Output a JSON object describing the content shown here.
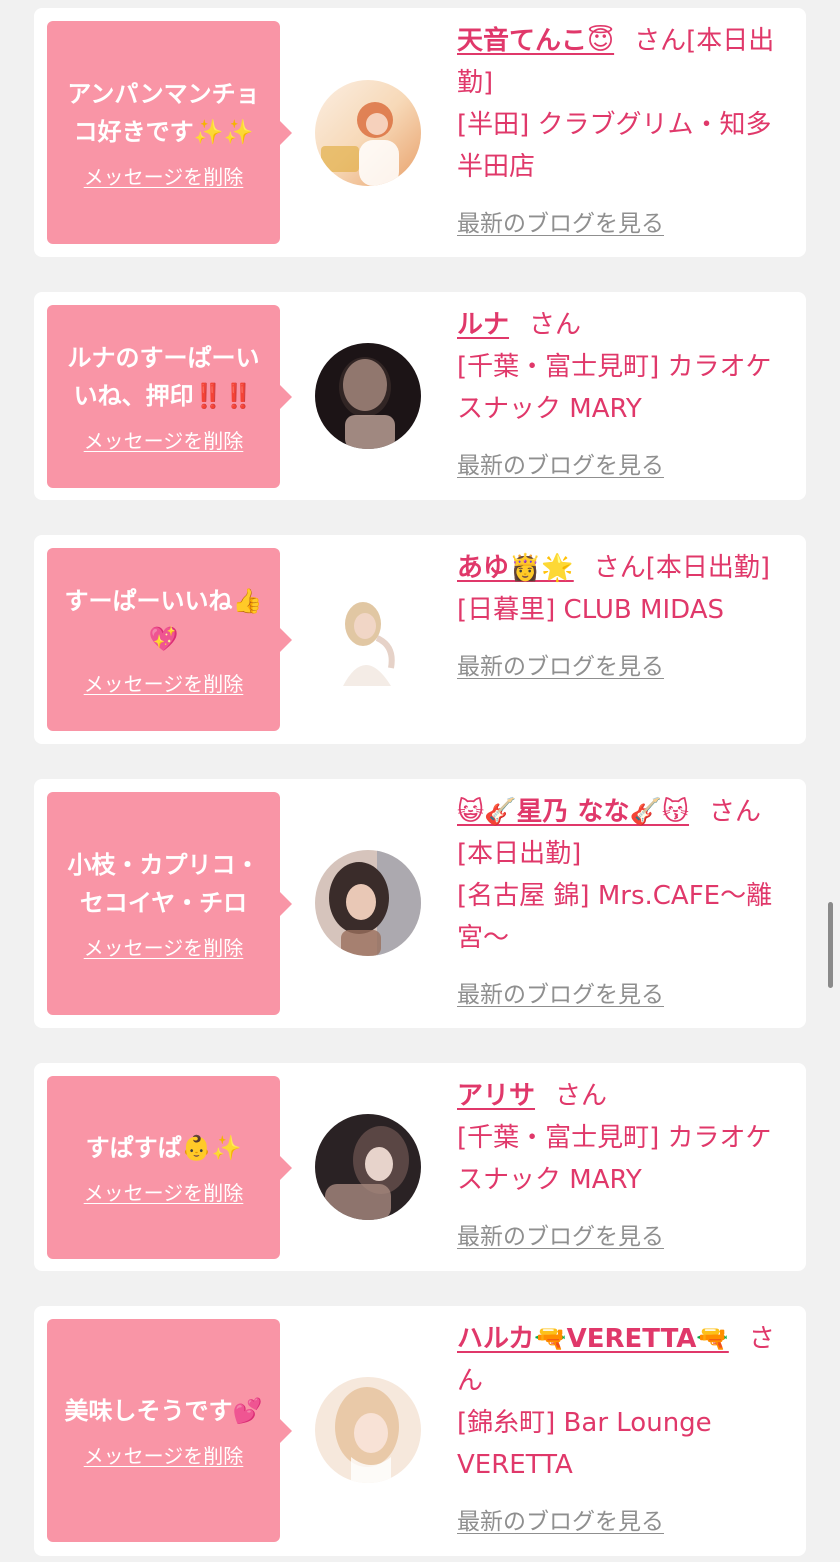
{
  "cards": [
    {
      "message": "アンパンマンチョコ好きです✨✨",
      "delete_label": "メッセージを削除",
      "name": "天音てんこ😇",
      "suffix": "さん[本日出勤]",
      "shop": "[半田] クラブグリム・知多半田店",
      "blog_label": "最新のブログを見る",
      "avatar_colors": [
        "#f7d9b8",
        "#e8a06a",
        "#fbeee2"
      ]
    },
    {
      "message": "ルナのすーぱーいいね、押印‼️‼️",
      "delete_label": "メッセージを削除",
      "name": "ルナ",
      "suffix": "さん",
      "shop": "[千葉・富士見町] カラオケスナック MARY",
      "blog_label": "最新のブログを見る",
      "avatar_colors": [
        "#1c1416",
        "#8a6a64",
        "#d8b9ae"
      ]
    },
    {
      "message": "すーぱーいいね👍💖",
      "delete_label": "メッセージを削除",
      "name": "あゆ👸🌟",
      "suffix": "さん[本日出勤]",
      "shop": "[日暮里] CLUB MIDAS",
      "blog_label": "最新のブログを見る",
      "avatar_colors": [
        "#ffffff",
        "#d9b98c",
        "#f4ece6"
      ]
    },
    {
      "message": "小枝・カプリコ・セコイヤ・チロ",
      "delete_label": "メッセージを削除",
      "name": "😺🎸星乃 なな🎸😽",
      "suffix": "さん[本日出勤]",
      "shop": "[名古屋 錦] Mrs.CAFE〜離宮〜",
      "blog_label": "最新のブログを見る",
      "avatar_colors": [
        "#3a2c2a",
        "#9a6f5c",
        "#d6c4bc"
      ]
    },
    {
      "message": "すぱすぱ👶✨",
      "delete_label": "メッセージを削除",
      "name": "アリサ",
      "suffix": "さん",
      "shop": "[千葉・富士見町] カラオケスナック MARY",
      "blog_label": "最新のブログを見る",
      "avatar_colors": [
        "#2a2224",
        "#a88a80",
        "#e7d3cb"
      ]
    },
    {
      "message": "美味しそうです💕",
      "delete_label": "メッセージを削除",
      "name": "ハルカ🔫VERETTA🔫",
      "suffix": "さん",
      "shop": "[錦糸町] Bar Lounge VERETTA",
      "blog_label": "最新のブログを見る",
      "avatar_colors": [
        "#e9c9a8",
        "#c28f6e",
        "#f6e8dc"
      ]
    }
  ]
}
